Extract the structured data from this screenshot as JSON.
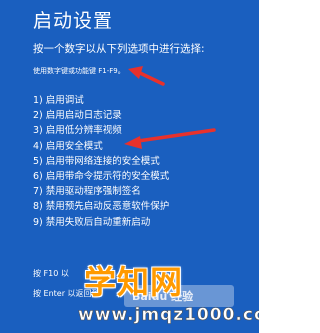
{
  "screen": {
    "title": "启动设置",
    "instruction": "按一个数字以从下列选项中进行选择:",
    "hint": "使用数字键或功能键 F1-F9。",
    "options": [
      "1) 启用调试",
      "2) 启用启动日志记录",
      "3) 启用低分辨率视频",
      "4) 启用安全模式",
      "5) 启用带网络连接的安全模式",
      "6) 启用带命令提示符的安全模式",
      "7) 禁用驱动程序强制签名",
      "8) 禁用预先启动反恶意软件保护",
      "9) 禁用失败后自动重新启动"
    ],
    "footer": {
      "line1": "按 F10 以",
      "line2": "按 Enter 以返回到"
    }
  },
  "watermark": {
    "main_text": "学知网",
    "url_text": "www.jmqz1000.com",
    "baidu_text": "Baidu 经验"
  },
  "colors": {
    "background": "#1a5fbf",
    "text": "#ffffff",
    "arrow": "#e8312c",
    "watermark": "#ff9a00"
  },
  "icons": {
    "annotation": "red-arrow-icon"
  }
}
